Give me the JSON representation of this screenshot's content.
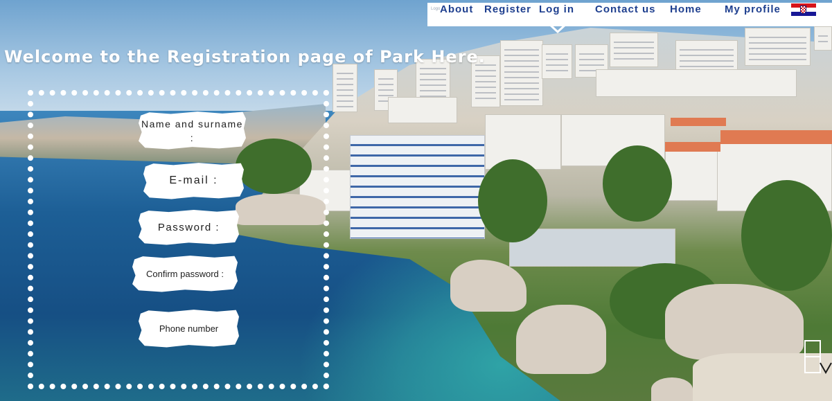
{
  "nav": {
    "logo_text": "Logo",
    "items": [
      {
        "id": "about",
        "label": "About"
      },
      {
        "id": "register",
        "label": "Register"
      },
      {
        "id": "login",
        "label": "Log in"
      },
      {
        "id": "contact",
        "label": "Contact us"
      },
      {
        "id": "home",
        "label": "Home"
      },
      {
        "id": "profile",
        "label": "My profile"
      }
    ],
    "language_flag_icon": "croatia-flag-icon",
    "dropdown_icon": "chevron-down-icon"
  },
  "page": {
    "title": "Welcome to the Registration page of Park Here."
  },
  "form": {
    "fields": {
      "name_label": "Name and surname :",
      "email_label": "E-mail :",
      "password_label": "Password :",
      "confirm_password_label": "Confirm password :",
      "phone_label": "Phone number"
    }
  },
  "colors": {
    "nav_text": "#1e3f8f",
    "nav_background": "#ffffff",
    "title_text": "#ffffff",
    "form_border": "#ffffff"
  }
}
